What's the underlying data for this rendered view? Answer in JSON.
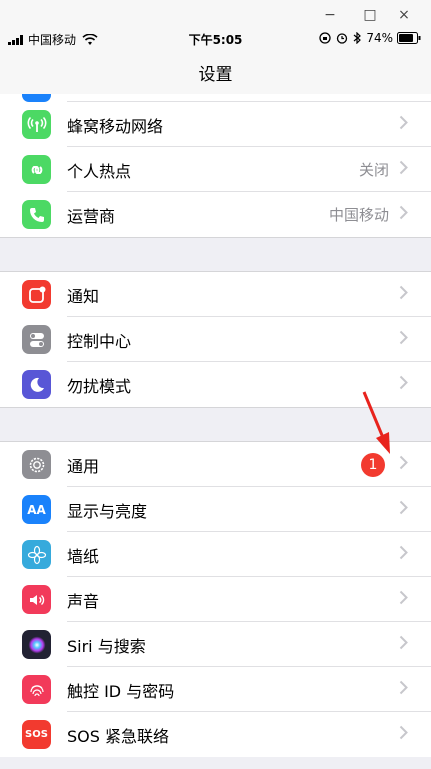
{
  "window": {
    "minimize": "−",
    "maximize": "□",
    "close": "×"
  },
  "status_bar": {
    "carrier": "中国移动",
    "time": "下午5:05",
    "battery": "74%"
  },
  "nav": {
    "title": "设置"
  },
  "groups": [
    [
      {
        "label": "蜂窝移动网络",
        "icon": "antenna-icon",
        "color": "#4cd964",
        "detail": ""
      },
      {
        "label": "个人热点",
        "icon": "hotspot-icon",
        "color": "#4cd964",
        "detail": "关闭"
      },
      {
        "label": "运营商",
        "icon": "phone-icon",
        "color": "#4cd964",
        "detail": "中国移动"
      }
    ],
    [
      {
        "label": "通知",
        "icon": "notification-icon",
        "color": "#f23a2f",
        "detail": ""
      },
      {
        "label": "控制中心",
        "icon": "control-center-icon",
        "color": "#8e8e93",
        "detail": ""
      },
      {
        "label": "勿扰模式",
        "icon": "moon-icon",
        "color": "#5856d6",
        "detail": ""
      }
    ],
    [
      {
        "label": "通用",
        "icon": "gear-icon",
        "color": "#8e8e93",
        "detail": "",
        "badge": "1"
      },
      {
        "label": "显示与亮度",
        "icon": "display-icon",
        "color": "#1a82fb",
        "detail": ""
      },
      {
        "label": "墙纸",
        "icon": "wallpaper-icon",
        "color": "#36aadc",
        "detail": ""
      },
      {
        "label": "声音",
        "icon": "speaker-icon",
        "color": "#f23a5a",
        "detail": ""
      },
      {
        "label": "Siri 与搜索",
        "icon": "siri-icon",
        "color": "#222233",
        "detail": ""
      },
      {
        "label": "触控 ID 与密码",
        "icon": "fingerprint-icon",
        "color": "#f23a5a",
        "detail": ""
      },
      {
        "label": "SOS 紧急联络",
        "icon": "sos-icon",
        "color": "#f23a2f",
        "detail": ""
      }
    ]
  ],
  "icon_text": {
    "display": "AA",
    "sos": "SOS"
  },
  "colors": {
    "background": "#efeff4",
    "chevron": "#c7c7cc",
    "badge": "#f23a2f",
    "annotation_arrow": "#e8231d"
  }
}
